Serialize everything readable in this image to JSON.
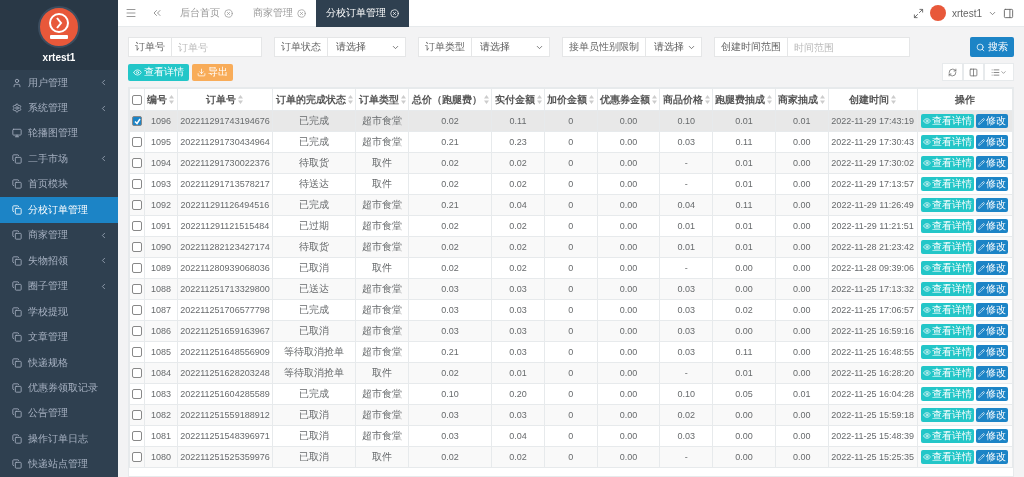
{
  "sidebar": {
    "user": "xrtest1",
    "items": [
      {
        "label": "用户管理",
        "expandable": true,
        "selected": false
      },
      {
        "label": "系统管理",
        "expandable": true,
        "selected": false
      },
      {
        "label": "轮播图管理",
        "expandable": false,
        "selected": false
      },
      {
        "label": "二手市场",
        "expandable": true,
        "selected": false
      },
      {
        "label": "首页模块",
        "expandable": false,
        "selected": false
      },
      {
        "label": "分校订单管理",
        "expandable": false,
        "selected": true
      },
      {
        "label": "商家管理",
        "expandable": true,
        "selected": false
      },
      {
        "label": "失物招领",
        "expandable": true,
        "selected": false
      },
      {
        "label": "圈子管理",
        "expandable": true,
        "selected": false
      },
      {
        "label": "学校提现",
        "expandable": false,
        "selected": false
      },
      {
        "label": "文章管理",
        "expandable": false,
        "selected": false
      },
      {
        "label": "快递规格",
        "expandable": false,
        "selected": false
      },
      {
        "label": "优惠券领取记录",
        "expandable": false,
        "selected": false
      },
      {
        "label": "公告管理",
        "expandable": false,
        "selected": false
      },
      {
        "label": "操作订单日志",
        "expandable": false,
        "selected": false
      },
      {
        "label": "快递站点管理",
        "expandable": false,
        "selected": false
      }
    ]
  },
  "tabs": [
    {
      "label": "后台首页",
      "selected": false
    },
    {
      "label": "商家管理",
      "selected": false
    },
    {
      "label": "分校订单管理",
      "selected": true
    }
  ],
  "header_user": "xrtest1",
  "filters": [
    {
      "kind": "input",
      "label": "订单号",
      "placeholder": "订单号"
    },
    {
      "kind": "select",
      "label": "订单状态",
      "value": "请选择"
    },
    {
      "kind": "select",
      "label": "订单类型",
      "value": "请选择"
    },
    {
      "kind": "select",
      "label": "接单员性别限制",
      "value": "请选择"
    },
    {
      "kind": "input",
      "label": "创建时间范围",
      "placeholder": "时间范围"
    }
  ],
  "search_button": "搜索",
  "toolbar": {
    "detail_button": "查看详情",
    "export_button": "导出"
  },
  "table": {
    "select_all": false,
    "columns": [
      {
        "label": "编号",
        "sortable": true
      },
      {
        "label": "订单号",
        "sortable": true
      },
      {
        "label": "订单的完成状态",
        "sortable": true
      },
      {
        "label": "订单类型",
        "sortable": true
      },
      {
        "label": "总价（跑腿费）",
        "sortable": true
      },
      {
        "label": "实付金额",
        "sortable": true
      },
      {
        "label": "加价金额",
        "sortable": true
      },
      {
        "label": "优惠券金额",
        "sortable": true
      },
      {
        "label": "商品价格",
        "sortable": true
      },
      {
        "label": "跑腿费抽成",
        "sortable": true
      },
      {
        "label": "商家抽成",
        "sortable": true
      },
      {
        "label": "创建时间",
        "sortable": true
      },
      {
        "label": "操作",
        "sortable": false
      }
    ],
    "rows": [
      {
        "selected": true,
        "cells": [
          "1096",
          "202211291743194676",
          "已完成",
          "超市食堂",
          "0.02",
          "0.11",
          "0",
          "0.00",
          "0.10",
          "0.01",
          "0.01",
          "2022-11-29 17:43:19"
        ],
        "actions": [
          "查看详情",
          "修改"
        ]
      },
      {
        "selected": false,
        "cells": [
          "1095",
          "202211291730434964",
          "已完成",
          "超市食堂",
          "0.21",
          "0.23",
          "0",
          "0.00",
          "0.03",
          "0.11",
          "0.00",
          "2022-11-29 17:30:43"
        ],
        "actions": [
          "查看详情",
          "修改"
        ]
      },
      {
        "selected": false,
        "cells": [
          "1094",
          "202211291730022376",
          "待取货",
          "取件",
          "0.02",
          "0.02",
          "0",
          "0.00",
          "-",
          "0.01",
          "0.00",
          "2022-11-29 17:30:02"
        ],
        "actions": [
          "查看详情",
          "修改"
        ]
      },
      {
        "selected": false,
        "cells": [
          "1093",
          "202211291713578217",
          "待送达",
          "取件",
          "0.02",
          "0.02",
          "0",
          "0.00",
          "-",
          "0.01",
          "0.00",
          "2022-11-29 17:13:57"
        ],
        "actions": [
          "查看详情",
          "修改"
        ]
      },
      {
        "selected": false,
        "cells": [
          "1092",
          "202211291126494516",
          "已完成",
          "超市食堂",
          "0.21",
          "0.04",
          "0",
          "0.00",
          "0.04",
          "0.11",
          "0.00",
          "2022-11-29 11:26:49"
        ],
        "actions": [
          "查看详情",
          "修改"
        ]
      },
      {
        "selected": false,
        "cells": [
          "1091",
          "202211291121515484",
          "已过期",
          "超市食堂",
          "0.02",
          "0.02",
          "0",
          "0.00",
          "0.01",
          "0.01",
          "0.00",
          "2022-11-29 11:21:51"
        ],
        "actions": [
          "查看详情",
          "修改"
        ]
      },
      {
        "selected": false,
        "cells": [
          "1090",
          "202211282123427174",
          "待取货",
          "超市食堂",
          "0.02",
          "0.02",
          "0",
          "0.00",
          "0.01",
          "0.01",
          "0.00",
          "2022-11-28 21:23:42"
        ],
        "actions": [
          "查看详情",
          "修改"
        ]
      },
      {
        "selected": false,
        "cells": [
          "1089",
          "202211280939068036",
          "已取消",
          "取件",
          "0.02",
          "0.02",
          "0",
          "0.00",
          "-",
          "0.00",
          "0.00",
          "2022-11-28 09:39:06"
        ],
        "actions": [
          "查看详情",
          "修改"
        ]
      },
      {
        "selected": false,
        "cells": [
          "1088",
          "202211251713329800",
          "已送达",
          "超市食堂",
          "0.03",
          "0.03",
          "0",
          "0.00",
          "0.03",
          "0.00",
          "0.00",
          "2022-11-25 17:13:32"
        ],
        "actions": [
          "查看详情",
          "修改"
        ]
      },
      {
        "selected": false,
        "cells": [
          "1087",
          "202211251706577798",
          "已完成",
          "超市食堂",
          "0.03",
          "0.03",
          "0",
          "0.00",
          "0.03",
          "0.02",
          "0.00",
          "2022-11-25 17:06:57"
        ],
        "actions": [
          "查看详情",
          "修改"
        ]
      },
      {
        "selected": false,
        "cells": [
          "1086",
          "202211251659163967",
          "已取消",
          "超市食堂",
          "0.03",
          "0.03",
          "0",
          "0.00",
          "0.03",
          "0.00",
          "0.00",
          "2022-11-25 16:59:16"
        ],
        "actions": [
          "查看详情",
          "修改"
        ]
      },
      {
        "selected": false,
        "cells": [
          "1085",
          "202211251648556909",
          "等待取消抢单",
          "超市食堂",
          "0.21",
          "0.03",
          "0",
          "0.00",
          "0.03",
          "0.11",
          "0.00",
          "2022-11-25 16:48:55"
        ],
        "actions": [
          "查看详情",
          "修改"
        ]
      },
      {
        "selected": false,
        "cells": [
          "1084",
          "202211251628203248",
          "等待取消抢单",
          "取件",
          "0.02",
          "0.01",
          "0",
          "0.00",
          "-",
          "0.01",
          "0.00",
          "2022-11-25 16:28:20"
        ],
        "actions": [
          "查看详情",
          "修改"
        ]
      },
      {
        "selected": false,
        "cells": [
          "1083",
          "202211251604285589",
          "已完成",
          "超市食堂",
          "0.10",
          "0.20",
          "0",
          "0.00",
          "0.10",
          "0.05",
          "0.01",
          "2022-11-25 16:04:28"
        ],
        "actions": [
          "查看详情",
          "修改"
        ]
      },
      {
        "selected": false,
        "cells": [
          "1082",
          "202211251559188912",
          "已取消",
          "超市食堂",
          "0.03",
          "0.03",
          "0",
          "0.00",
          "0.02",
          "0.00",
          "0.00",
          "2022-11-25 15:59:18"
        ],
        "actions": [
          "查看详情",
          "修改"
        ]
      },
      {
        "selected": false,
        "cells": [
          "1081",
          "202211251548396971",
          "已取消",
          "超市食堂",
          "0.03",
          "0.04",
          "0",
          "0.00",
          "0.03",
          "0.00",
          "0.00",
          "2022-11-25 15:48:39"
        ],
        "actions": [
          "查看详情",
          "修改"
        ]
      },
      {
        "selected": false,
        "cells": [
          "1080",
          "202211251525359976",
          "已取消",
          "取件",
          "0.02",
          "0.02",
          "0",
          "0.00",
          "-",
          "0.00",
          "0.00",
          "2022-11-25 15:25:35"
        ],
        "actions": [
          "查看详情",
          "修改"
        ]
      }
    ]
  }
}
